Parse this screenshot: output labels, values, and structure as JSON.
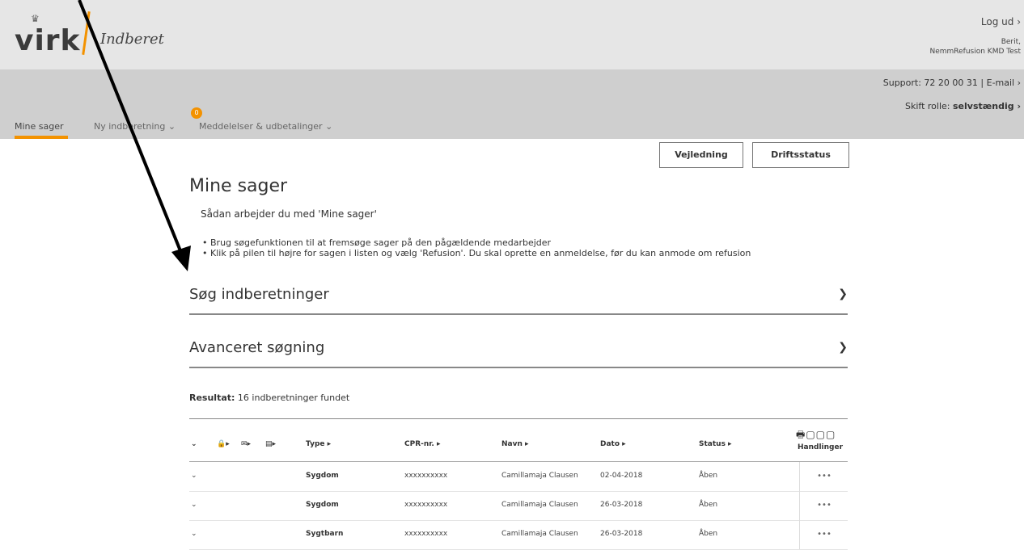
{
  "header": {
    "logo_text": "virk",
    "app_name": "Indberet",
    "logout_label": "Log ud ›",
    "user_name": "Berit,",
    "user_company": "NemmRefusion KMD Test",
    "support_label": "Support: 72 20 00 31 | E-mail ›",
    "role_prefix": "Skift rolle: ",
    "role_value": "selvstændig ›"
  },
  "nav": {
    "items": [
      {
        "label": "Mine sager"
      },
      {
        "label": "Ny indberetning ⌄"
      },
      {
        "label": "Meddelelser & udbetalinger ⌄"
      }
    ],
    "badge_count": "0",
    "accent_color": "#f39200"
  },
  "buttons": {
    "guide": "Vejledning",
    "status": "Driftsstatus"
  },
  "main": {
    "title": "Mine sager",
    "intro": "Sådan arbejder du med 'Mine sager'",
    "bullets": [
      "Brug søgefunktionen til at fremsøge sager på den pågældende medarbejder",
      "Klik på pilen til højre for sagen i listen og vælg 'Refusion'. Du skal oprette en anmeldelse, før du kan anmode om refusion"
    ],
    "section_search": "Søg indberetninger",
    "section_advanced": "Avanceret søgning",
    "result_label": "Resultat:",
    "result_text": " 16 indberetninger fundet"
  },
  "table": {
    "headers": {
      "type": "Type ▸",
      "cpr": "CPR-nr. ▸",
      "name": "Navn ▸",
      "date": "Dato ▸",
      "status": "Status ▸",
      "actions": "Handlinger"
    },
    "rows": [
      {
        "type": "Sygdom",
        "cpr": "xxxxxxxxxx",
        "name": "Camillamaja Clausen",
        "date": "02-04-2018",
        "status": "Åben",
        "actions": "•••"
      },
      {
        "type": "Sygdom",
        "cpr": "xxxxxxxxxx",
        "name": "Camillamaja Clausen",
        "date": "26-03-2018",
        "status": "Åben",
        "actions": "•••"
      },
      {
        "type": "Sygtbarn",
        "cpr": "xxxxxxxxxx",
        "name": "Camillamaja Clausen",
        "date": "26-03-2018",
        "status": "Åben",
        "actions": "•••"
      }
    ]
  }
}
